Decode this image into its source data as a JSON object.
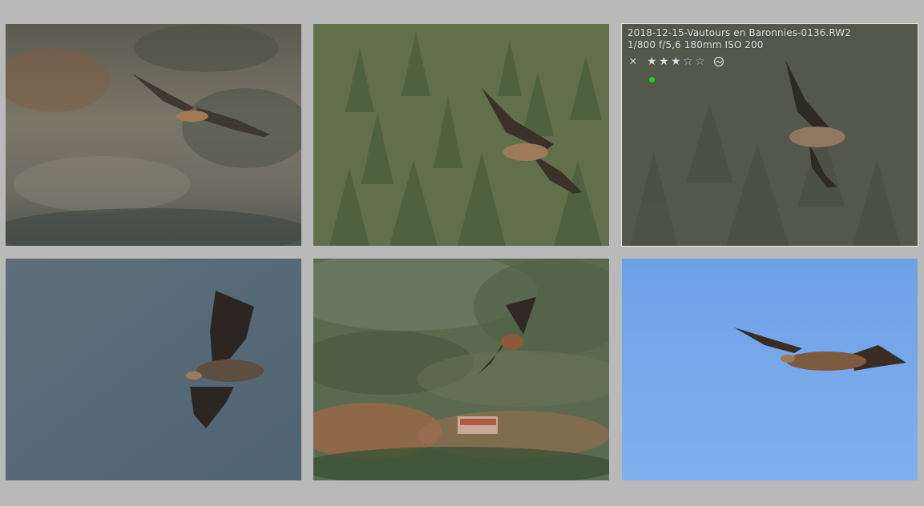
{
  "thumbnails": [
    {
      "id": 1,
      "scene": "cliff"
    },
    {
      "id": 2,
      "scene": "forest"
    },
    {
      "id": 3,
      "scene": "dark-forest",
      "selected": true,
      "filename": "2018-12-15-Vautours en Baronnies-0136.RW2",
      "exif": "1/800 f/5,6 180mm ISO 200",
      "rating": 3,
      "max_rating": 5,
      "color_label": "#19d419",
      "icons": {
        "reject": "close-icon",
        "star_filled": "star-icon",
        "star_empty": "star-outline-icon",
        "altered": "altered-icon"
      }
    },
    {
      "id": 4,
      "scene": "gray-sky"
    },
    {
      "id": 5,
      "scene": "hillside"
    },
    {
      "id": 6,
      "scene": "blue-sky"
    }
  ],
  "colors": {
    "background": "#b9b9b9",
    "overlay_text": "#e4e4e4",
    "selection_border": "#e8e8e8"
  }
}
